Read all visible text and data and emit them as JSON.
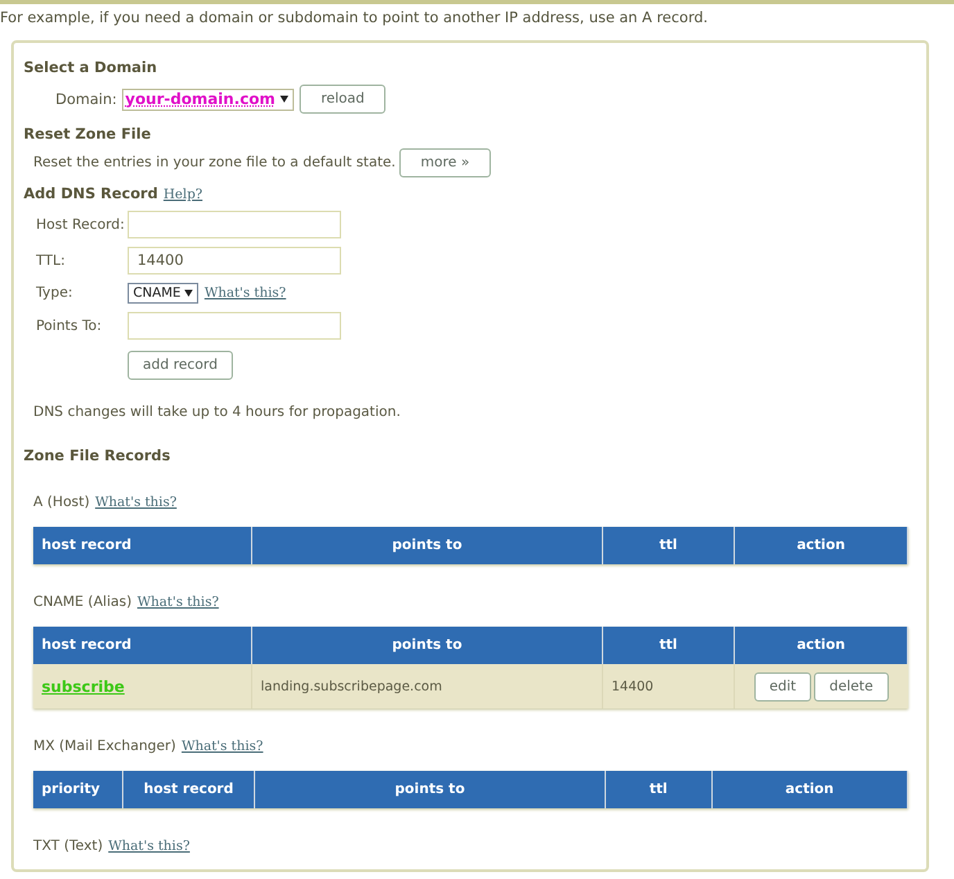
{
  "intro": "For example, if you need a domain or subdomain to point to another IP address, use an A record.",
  "select_domain": {
    "heading": "Select a Domain",
    "label": "Domain:",
    "value": "your-domain.com",
    "button": "reload"
  },
  "reset_zone": {
    "heading": "Reset Zone File",
    "text": "Reset the entries in your zone file to a default state.",
    "button": "more »"
  },
  "add_record": {
    "heading": "Add DNS Record",
    "help_link": "Help?",
    "fields": [
      {
        "kind": "text",
        "label": "Host Record:"
      },
      {
        "kind": "text",
        "label": "TTL:",
        "value": "14400"
      },
      {
        "kind": "select",
        "label": "Type:",
        "value": "CNAME",
        "help_link": "What's this?"
      },
      {
        "kind": "text",
        "label": "Points To:"
      }
    ],
    "button": "add record",
    "note": "DNS changes will take up to 4 hours for propagation."
  },
  "zone_records": {
    "heading": "Zone File Records",
    "tables": [
      {
        "title": "A (Host)",
        "help_link": "What's this?",
        "columns": [
          "host record",
          "points to",
          "ttl",
          "action"
        ]
      },
      {
        "title": "CNAME (Alias)",
        "help_link": "What's this?",
        "columns": [
          "host record",
          "points to",
          "ttl",
          "action"
        ],
        "rows": [
          {
            "host": "subscribe",
            "points_to": "landing.subscribepage.com",
            "ttl": "14400",
            "actions": [
              "edit",
              "delete"
            ]
          }
        ]
      },
      {
        "title": "MX (Mail Exchanger)",
        "help_link": "What's this?",
        "columns": [
          "priority",
          "host record",
          "points to",
          "ttl",
          "action"
        ]
      },
      {
        "title": "TXT (Text)",
        "help_link": "What's this?"
      }
    ]
  }
}
